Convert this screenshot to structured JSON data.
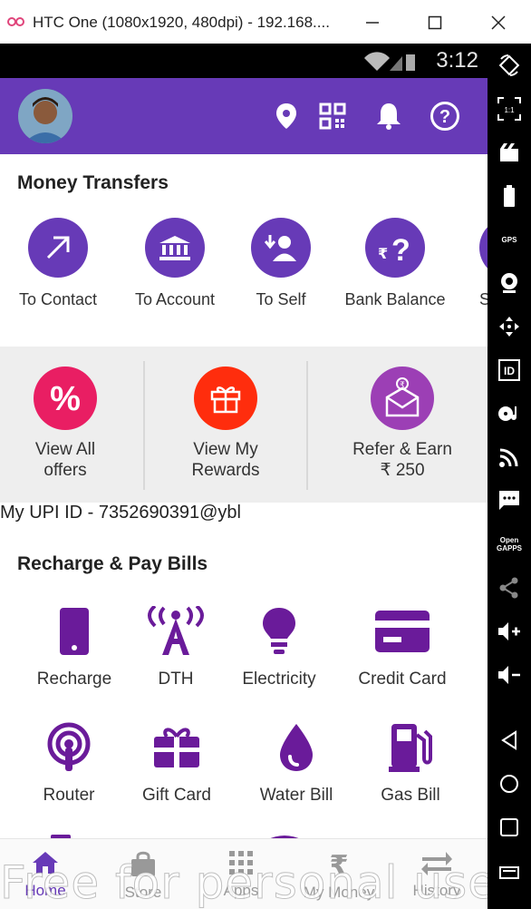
{
  "window": {
    "title": "HTC One (1080x1920, 480dpi) - 192.168....",
    "minimize": "—",
    "maximize": "☐",
    "close": "✕"
  },
  "status": {
    "time": "3:12"
  },
  "appbar": {
    "icons": [
      "location-icon",
      "qr-code-icon",
      "bell-icon",
      "help-icon"
    ],
    "accent": "#673ab7"
  },
  "money_transfers": {
    "title": "Money Transfers",
    "items": [
      {
        "label": "To Contact",
        "icon": "arrow-up-right-icon"
      },
      {
        "label": "To Account",
        "icon": "bank-icon"
      },
      {
        "label": "To Self",
        "icon": "self-transfer-icon"
      },
      {
        "label": "Bank Balance",
        "icon": "balance-query-icon"
      },
      {
        "label": "S",
        "icon": "more-icon"
      }
    ]
  },
  "offers": [
    {
      "label": "View All offers",
      "color": "#e91e63",
      "icon": "percent-icon"
    },
    {
      "label": "View My Rewards",
      "color": "#ff2d0d",
      "icon": "gift-icon"
    },
    {
      "label": "Refer & Earn ₹ 250",
      "color": "#9c3fb5",
      "icon": "refer-envelope-icon"
    }
  ],
  "offers_text": {
    "view_all_1": "View All",
    "view_all_2": "offers",
    "rewards_1": "View My",
    "rewards_2": "Rewards",
    "refer_1": "Refer & Earn",
    "refer_2": "₹ 250"
  },
  "upi": {
    "text": "My UPI ID - 7352690391@ybl"
  },
  "recharge": {
    "title": "Recharge & Pay Bills",
    "items": [
      {
        "label": "Recharge",
        "icon": "mobile-icon"
      },
      {
        "label": "DTH",
        "icon": "antenna-icon"
      },
      {
        "label": "Electricity",
        "icon": "bulb-icon"
      },
      {
        "label": "Credit Card",
        "icon": "credit-card-icon"
      },
      {
        "label": "Router",
        "icon": "router-icon"
      },
      {
        "label": "Gift Card",
        "icon": "gift-card-icon"
      },
      {
        "label": "Water Bill",
        "icon": "water-drop-icon"
      },
      {
        "label": "Gas Bill",
        "icon": "gas-pump-icon"
      }
    ]
  },
  "bottom_nav": [
    {
      "label": "Home",
      "icon": "home-icon",
      "active": true
    },
    {
      "label": "Store",
      "icon": "store-bag-icon",
      "active": false
    },
    {
      "label": "Apps",
      "icon": "apps-grid-icon",
      "active": false
    },
    {
      "label": "My Money",
      "icon": "rupee-icon",
      "active": false
    },
    {
      "label": "History",
      "icon": "swap-arrows-icon",
      "active": false
    }
  ],
  "watermark": "Free for personal use",
  "sidebar": {
    "items": [
      "rotate-icon",
      "pixel-perfect-icon",
      "screenshot-icon",
      "battery-icon",
      "gps-icon",
      "camera-icon",
      "dpad-icon",
      "identifiers-icon",
      "media-icon",
      "cast-icon",
      "sms-icon",
      "opengapps-icon",
      "share-icon",
      "volume-up-icon",
      "volume-down-icon",
      "back-icon",
      "home-circle-icon",
      "recent-apps-icon",
      "menu-icon"
    ],
    "gps_text": "GPS",
    "id_text": "ID",
    "open_text": "Open",
    "gapps_text": "GAPPS",
    "ratio_text": "1:1"
  }
}
